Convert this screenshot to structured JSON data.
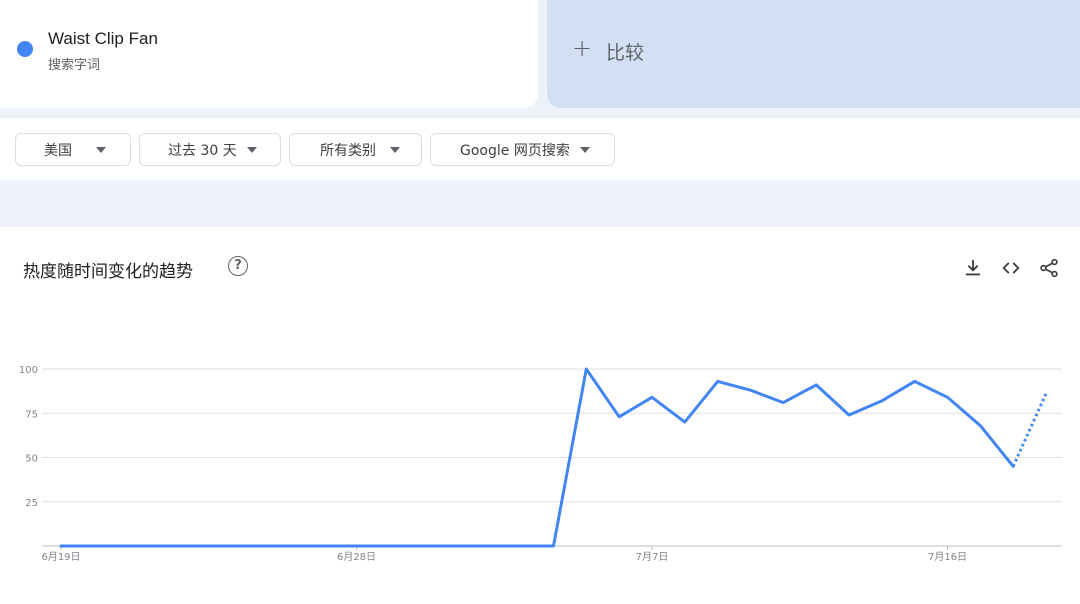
{
  "search_term": {
    "name": "Waist Clip Fan",
    "type": "搜索字词",
    "color": "#4285f4"
  },
  "compare": {
    "icon": "plus-icon",
    "label": "比较"
  },
  "filters": [
    {
      "label": "美国"
    },
    {
      "label": "过去 30 天"
    },
    {
      "label": "所有类别"
    },
    {
      "label": "Google 网页搜索"
    }
  ],
  "chart_panel": {
    "title": "热度随时间变化的趋势",
    "help_icon": "?",
    "tools": [
      "download-icon",
      "embed-code-icon",
      "share-icon"
    ]
  },
  "chart_data": {
    "type": "line",
    "title": "热度随时间变化的趋势",
    "xlabel": "",
    "ylabel": "",
    "ylim": [
      0,
      100
    ],
    "yticks": [
      25,
      50,
      75,
      100
    ],
    "xticks": [
      "6月19日",
      "6月28日",
      "7月7日",
      "7月16日"
    ],
    "grid": true,
    "series": [
      {
        "color": "#4285f4",
        "x": [
          "6月19日",
          "6月20日",
          "6月21日",
          "6月22日",
          "6月23日",
          "6月24日",
          "6月25日",
          "6月26日",
          "6月27日",
          "6月28日",
          "6月29日",
          "6月30日",
          "7月1日",
          "7月2日",
          "7月3日",
          "7月4日",
          "7月5日",
          "7月6日",
          "7月7日",
          "7月8日",
          "7月9日",
          "7月10日",
          "7月11日",
          "7月12日",
          "7月13日",
          "7月14日",
          "7月15日",
          "7月16日",
          "7月17日",
          "7月18日",
          "7月19日"
        ],
        "values": [
          0,
          0,
          0,
          0,
          0,
          0,
          0,
          0,
          0,
          0,
          0,
          0,
          0,
          0,
          0,
          0,
          100,
          73,
          84,
          70,
          93,
          88,
          81,
          91,
          74,
          82,
          93,
          84,
          68,
          45,
          86
        ],
        "partial_from_index": 29
      }
    ]
  }
}
